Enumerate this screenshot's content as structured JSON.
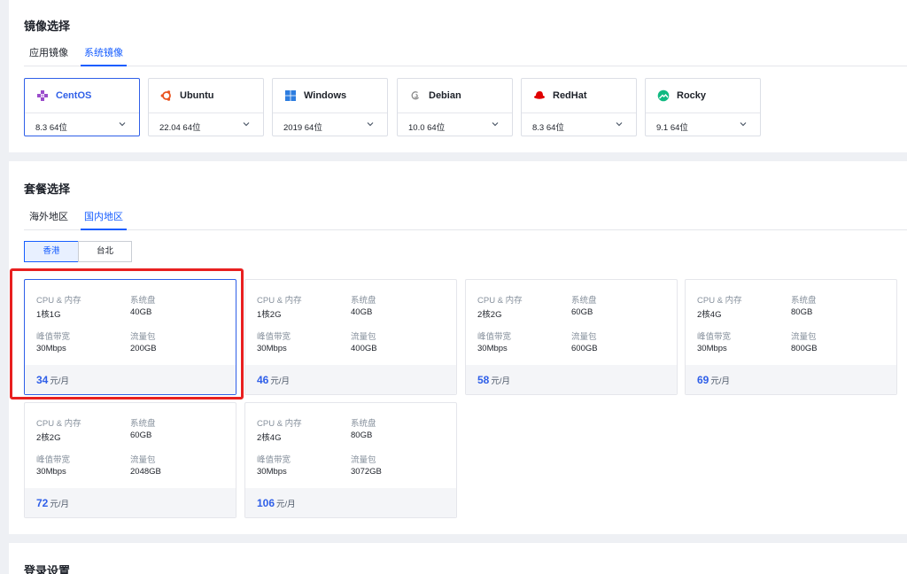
{
  "image_section": {
    "title": "镜像选择",
    "tabs": [
      {
        "label": "应用镜像"
      },
      {
        "label": "系统镜像"
      }
    ],
    "os_cards": [
      {
        "name": "CentOS",
        "version": "8.3 64位",
        "icon": "centos-icon",
        "color": "#9b4dcb"
      },
      {
        "name": "Ubuntu",
        "version": "22.04 64位",
        "icon": "ubuntu-icon",
        "color": "#e95420"
      },
      {
        "name": "Windows",
        "version": "2019 64位",
        "icon": "windows-icon",
        "color": "#2d7de0"
      },
      {
        "name": "Debian",
        "version": "10.0 64位",
        "icon": "debian-icon",
        "color": "#8c8c8c"
      },
      {
        "name": "RedHat",
        "version": "8.3 64位",
        "icon": "redhat-icon",
        "color": "#e00000"
      },
      {
        "name": "Rocky",
        "version": "9.1 64位",
        "icon": "rocky-icon",
        "color": "#10b981"
      }
    ]
  },
  "plan_section": {
    "title": "套餐选择",
    "tabs": [
      {
        "label": "海外地区"
      },
      {
        "label": "国内地区"
      }
    ],
    "regions": [
      {
        "label": "香港"
      },
      {
        "label": "台北"
      }
    ],
    "field_labels": {
      "cpu": "CPU & 内存",
      "disk": "系统盘",
      "bandwidth": "峰值带宽",
      "traffic": "流量包",
      "unit": "元/月"
    },
    "plans": [
      {
        "cpu": "1核1G",
        "disk": "40GB",
        "bandwidth": "30Mbps",
        "traffic": "200GB",
        "price": "34"
      },
      {
        "cpu": "1核2G",
        "disk": "40GB",
        "bandwidth": "30Mbps",
        "traffic": "400GB",
        "price": "46"
      },
      {
        "cpu": "2核2G",
        "disk": "60GB",
        "bandwidth": "30Mbps",
        "traffic": "600GB",
        "price": "58"
      },
      {
        "cpu": "2核4G",
        "disk": "80GB",
        "bandwidth": "30Mbps",
        "traffic": "800GB",
        "price": "69"
      },
      {
        "cpu": "2核2G",
        "disk": "60GB",
        "bandwidth": "30Mbps",
        "traffic": "2048GB",
        "price": "72"
      },
      {
        "cpu": "2核4G",
        "disk": "80GB",
        "bandwidth": "30Mbps",
        "traffic": "3072GB",
        "price": "106"
      }
    ]
  },
  "login_section": {
    "title": "登录设置"
  },
  "colors": {
    "accent": "#165dff",
    "highlight": "#e82020"
  }
}
